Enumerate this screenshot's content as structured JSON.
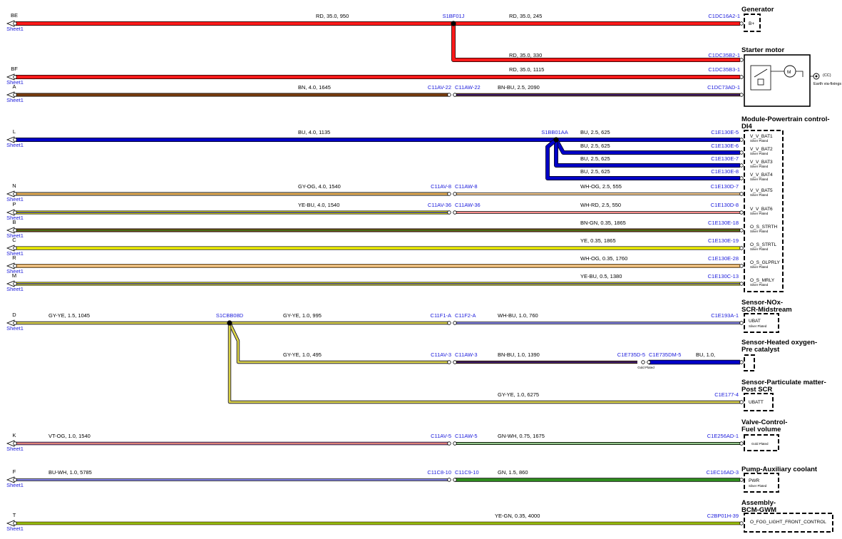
{
  "colors": {
    "RD": "#ff1a1a",
    "BN": "#7a3d0f",
    "BU": "#0000c8",
    "GY": "#bdb08a",
    "OG": "#f59a1b",
    "YE": "#f2f200",
    "GN": "#2e8b1e",
    "WH": "#ffffff",
    "VT": "#c56fd0",
    "BK": "#000000",
    "label_blue": "#1a1adb"
  },
  "components": [
    {
      "name": "Generator",
      "pins": [
        "B+"
      ]
    },
    {
      "name": "Starter motor",
      "earth": "Earth via-fixings",
      "earth_code": "(CC)"
    },
    {
      "name_lines": [
        "Module-Powertrain control-",
        "DI4"
      ],
      "pins": [
        {
          "label": "V_V_BAT1",
          "plating": "Silver Plated"
        },
        {
          "label": "V_V_BAT2",
          "plating": "Silver Plated"
        },
        {
          "label": "V_V_BAT3",
          "plating": "Silver Plated"
        },
        {
          "label": "V_V_BAT4",
          "plating": "Silver Plated"
        },
        {
          "label": "V_V_BAT5",
          "plating": "Silver Plated"
        },
        {
          "label": "V_V_BAT6",
          "plating": "Silver Plated"
        },
        {
          "label": "O_S_STRTH",
          "plating": "Silver Plated"
        },
        {
          "label": "O_S_STRTL",
          "plating": "Silver Plated"
        },
        {
          "label": "O_S_GLPRLY",
          "plating": "Silver Plated"
        },
        {
          "label": "O_S_MRLY",
          "plating": "Silver Plated"
        }
      ]
    },
    {
      "name_lines": [
        "Sensor-NOx-",
        "SCR-Midstream"
      ],
      "pin": "UBAT",
      "plating": "Silver Plated"
    },
    {
      "name_lines": [
        "Sensor-Heated oxygen-",
        "Pre catalyst"
      ]
    },
    {
      "name_lines": [
        "Sensor-Particulate matter-",
        "Post SCR"
      ],
      "pin": "UBATT"
    },
    {
      "name_lines": [
        "Valve-Control-",
        "Fuel volume"
      ],
      "plating": "Gold Plated"
    },
    {
      "name_lines": [
        "Pump-Auxiliary coolant"
      ],
      "pin": "PWR",
      "plating": "Silver Plated"
    },
    {
      "name_lines": [
        "Assembly-",
        "BCM-GWM"
      ],
      "pin": "O_FOG_LIGHT_FRONT_CONTROL"
    }
  ],
  "offsheet": [
    {
      "label": "BE",
      "sheet": "Sheet1"
    },
    {
      "label": "BF",
      "sheet": "Sheet1"
    },
    {
      "label": "A",
      "sheet": "Sheet1"
    },
    {
      "label": "L",
      "sheet": "Sheet1"
    },
    {
      "label": "N",
      "sheet": "Sheet1"
    },
    {
      "label": "P",
      "sheet": "Sheet1"
    },
    {
      "label": "B",
      "sheet": "Sheet1"
    },
    {
      "label": "C",
      "sheet": "Sheet1"
    },
    {
      "label": "R",
      "sheet": "Sheet1"
    },
    {
      "label": "M",
      "sheet": "Sheet1"
    },
    {
      "label": "D",
      "sheet": "Sheet1"
    },
    {
      "label": "K",
      "sheet": "Sheet1"
    },
    {
      "label": "F",
      "sheet": "Sheet1"
    },
    {
      "label": "T",
      "sheet": "Sheet1"
    }
  ],
  "wire_labels": [
    "RD, 35.0, 950",
    "RD, 35.0, 245",
    "RD, 35.0, 330",
    "RD, 35.0, 1115",
    "BN, 4.0, 1645",
    "BN-BU, 2.5, 2090",
    "BU, 4.0, 1135",
    "BU, 2.5, 625",
    "BU, 2.5, 625",
    "BU, 2.5, 625",
    "BU, 2.5, 625",
    "GY-OG, 4.0, 1540",
    "WH-OG, 2.5, 555",
    "YE-BU, 4.0, 1540",
    "WH-RD, 2.5, 550",
    "BN-GN, 0.35, 1865",
    "YE, 0.35, 1865",
    "WH-OG, 0.35, 1760",
    "YE-BU, 0.5, 1380",
    "GY-YE, 1.5, 1045",
    "GY-YE, 1.0, 995",
    "WH-BU, 1.0, 760",
    "GY-YE, 1.0, 495",
    "BN-BU, 1.0, 1390",
    "BU, 1.0,",
    "GY-YE, 1.0, 6275",
    "VT-OG, 1.0, 1540",
    "GN-WH, 0.75, 1675",
    "BU-WH, 1.0, 5785",
    "GN, 1.5, 860",
    "YE-GN, 0.35, 4000"
  ],
  "connector_labels": [
    "S1BF01J",
    "C1DC16A2-1",
    "C1DC35B2-1",
    "C1DC35B3-1",
    "C11AV-22",
    "C11AW-22",
    "C1DC73AD-1",
    "S1BB01AA",
    "C1E130E-5",
    "C1E130E-6",
    "C1E130E-7",
    "C1E130E-8",
    "C11AV-8",
    "C11AW-8",
    "C1E130D-7",
    "C11AV-36",
    "C11AW-36",
    "C1E130D-8",
    "C1E130E-18",
    "C1E130E-19",
    "C1E130E-28",
    "C1E130C-13",
    "S1CBB08D",
    "C11F1-A",
    "C11F2-A",
    "C1E193A-1",
    "C11AV-3",
    "C11AW-3",
    "C1E735D-5",
    "C1E735DM-5",
    "C1E177-4",
    "C11AV-5",
    "C11AW-5",
    "C1E256AD-1",
    "C11C8-10",
    "C11C9-10",
    "C1EC16AD-3",
    "C2BP01H-39"
  ],
  "notes": [
    "Gold Plated"
  ]
}
